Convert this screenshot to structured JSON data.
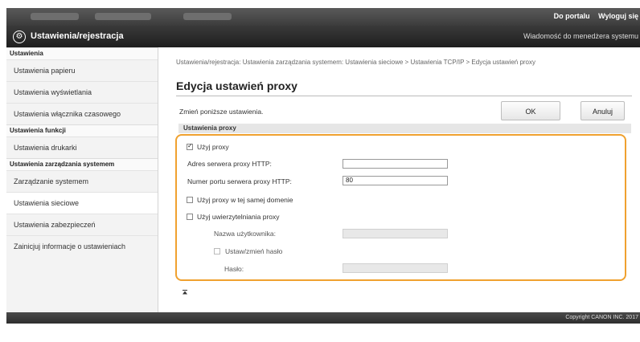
{
  "header": {
    "portal_link": "Do portalu",
    "logout_link": "Wyloguj się",
    "app_title": "Ustawienia/rejestracja",
    "message_link": "Wiadomość do menedżera systemu"
  },
  "sidebar": {
    "sections": [
      {
        "title": "Ustawienia",
        "items": [
          "Ustawienia papieru",
          "Ustawienia wyświetlania",
          "Ustawienia włącznika czasowego"
        ]
      },
      {
        "title": "Ustawienia funkcji",
        "items": [
          "Ustawienia drukarki"
        ]
      },
      {
        "title": "Ustawienia zarządzania systemem",
        "items": [
          "Zarządzanie systemem",
          "Ustawienia sieciowe",
          "Ustawienia zabezpieczeń",
          "Zainicjuj informacje o ustawieniach"
        ]
      }
    ]
  },
  "main": {
    "breadcrumb": "Ustawienia/rejestracja: Ustawienia zarządzania systemem: Ustawienia sieciowe > Ustawienia TCP/IP > Edycja ustawień proxy",
    "page_title": "Edycja ustawień proxy",
    "instruction": "Zmień poniższe ustawienia.",
    "ok_button": "OK",
    "cancel_button": "Anuluj",
    "section_title": "Ustawienia proxy",
    "use_proxy_label": "Użyj proxy",
    "use_proxy_checked": true,
    "http_server_label": "Adres serwera proxy HTTP:",
    "http_server_value": "",
    "port_label": "Numer portu serwera proxy HTTP:",
    "port_value": "80",
    "same_domain_label": "Użyj proxy w tej samej domenie",
    "same_domain_checked": false,
    "auth_label": "Użyj uwierzytelniania proxy",
    "auth_checked": false,
    "username_label": "Nazwa użytkownika:",
    "username_value": "",
    "set_password_label": "Ustaw/zmień hasło",
    "set_password_checked": false,
    "password_label": "Hasło:",
    "password_value": ""
  },
  "footer": {
    "copyright": "Copyright CANON INC. 2017"
  },
  "colors": {
    "highlight": "#f0a12f",
    "header_dark": "#1e1e1e",
    "sidebar_bg": "#f3f3f3"
  }
}
